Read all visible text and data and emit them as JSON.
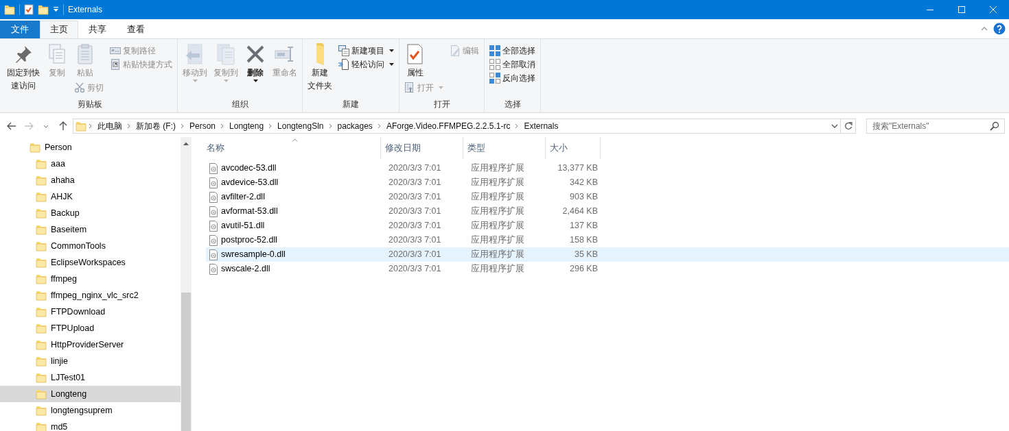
{
  "window": {
    "title": "Externals"
  },
  "ribbon": {
    "tabs": [
      {
        "label": "文件",
        "kind": "file",
        "selected": false
      },
      {
        "label": "主页",
        "kind": "tab",
        "selected": true
      },
      {
        "label": "共享",
        "kind": "tab",
        "selected": false
      },
      {
        "label": "查看",
        "kind": "tab",
        "selected": false
      }
    ],
    "groups": [
      {
        "label": "剪贴板",
        "columns": [
          [
            {
              "lines": [
                "固定到快",
                "速访问"
              ],
              "kind": "large",
              "disabled": false,
              "dropdown": false
            }
          ],
          [
            {
              "lines": [
                "复制"
              ],
              "kind": "large",
              "disabled": true,
              "dropdown": false
            }
          ],
          [
            {
              "lines": [
                "粘贴"
              ],
              "kind": "large",
              "disabled": true,
              "dropdown": false
            },
            {
              "lines": [
                "剪切"
              ],
              "kind": "small",
              "disabled": true,
              "dropdown": false
            }
          ],
          [
            {
              "lines": [
                "复制路径"
              ],
              "kind": "small",
              "disabled": true,
              "dropdown": false
            },
            {
              "lines": [
                "粘贴快捷方式"
              ],
              "kind": "small",
              "disabled": true,
              "dropdown": false
            }
          ]
        ]
      },
      {
        "label": "组织",
        "columns": [
          [
            {
              "lines": [
                "移动到"
              ],
              "kind": "large",
              "disabled": true,
              "dropdown": true
            }
          ],
          [
            {
              "lines": [
                "复制到"
              ],
              "kind": "large",
              "disabled": true,
              "dropdown": true
            }
          ],
          [
            {
              "lines": [
                "删除"
              ],
              "kind": "large",
              "disabled": false,
              "dropdown": true
            }
          ],
          [
            {
              "lines": [
                "重命名"
              ],
              "kind": "large",
              "disabled": true,
              "dropdown": false
            }
          ]
        ]
      },
      {
        "label": "新建",
        "columns": [
          [
            {
              "lines": [
                "新建",
                "文件夹"
              ],
              "kind": "large",
              "disabled": false,
              "dropdown": false
            }
          ],
          [
            {
              "lines": [
                "新建项目"
              ],
              "kind": "small",
              "disabled": false,
              "dropdown": true
            },
            {
              "lines": [
                "轻松访问"
              ],
              "kind": "small",
              "disabled": false,
              "dropdown": true
            }
          ]
        ]
      },
      {
        "label": "打开",
        "columns": [
          [
            {
              "lines": [
                "属性"
              ],
              "kind": "large",
              "disabled": false,
              "dropdown": false
            },
            {
              "lines": [
                "打开"
              ],
              "kind": "small",
              "disabled": true,
              "dropdown": true
            }
          ],
          [
            {
              "lines": [
                "编辑"
              ],
              "kind": "small",
              "disabled": true,
              "dropdown": false
            }
          ]
        ]
      },
      {
        "label": "选择",
        "columns": [
          [
            {
              "lines": [
                "全部选择"
              ],
              "kind": "small",
              "disabled": false,
              "dropdown": false
            },
            {
              "lines": [
                "全部取消"
              ],
              "kind": "small",
              "disabled": false,
              "dropdown": false
            },
            {
              "lines": [
                "反向选择"
              ],
              "kind": "small",
              "disabled": false,
              "dropdown": false
            }
          ]
        ]
      }
    ]
  },
  "navigation": {
    "back_disabled": false,
    "forward_disabled": true
  },
  "address": {
    "crumbs": [
      "此电脑",
      "新加卷 (F:)",
      "Person",
      "Longteng",
      "LongtengSln",
      "packages",
      "AForge.Video.FFMPEG.2.2.5.1-rc",
      "Externals"
    ]
  },
  "search": {
    "placeholder": "搜索\"Externals\""
  },
  "tree": [
    {
      "label": "Person",
      "selected": false,
      "children": [
        {
          "label": "aaa",
          "selected": false
        },
        {
          "label": "ahaha",
          "selected": false
        },
        {
          "label": "AHJK",
          "selected": false
        },
        {
          "label": "Backup",
          "selected": false
        },
        {
          "label": "Baseitem",
          "selected": false
        },
        {
          "label": "CommonTools",
          "selected": false
        },
        {
          "label": "EclipseWorkspaces",
          "selected": false
        },
        {
          "label": "ffmpeg",
          "selected": false
        },
        {
          "label": "ffmpeg_nginx_vlc_src2",
          "selected": false
        },
        {
          "label": "FTPDownload",
          "selected": false
        },
        {
          "label": "FTPUpload",
          "selected": false
        },
        {
          "label": "HttpProviderServer",
          "selected": false
        },
        {
          "label": "linjie",
          "selected": false
        },
        {
          "label": "LJTest01",
          "selected": false
        },
        {
          "label": "Longteng",
          "selected": true
        },
        {
          "label": "longtengsuprem",
          "selected": false
        },
        {
          "label": "md5",
          "selected": false
        }
      ]
    }
  ],
  "table": {
    "columns": [
      {
        "label": "名称",
        "sorted": true
      },
      {
        "label": "修改日期",
        "sorted": false
      },
      {
        "label": "类型",
        "sorted": false
      },
      {
        "label": "大小",
        "sorted": false
      }
    ],
    "rows": [
      {
        "name": "avcodec-53.dll",
        "date": "2020/3/3 7:01",
        "type": "应用程序扩展",
        "size": "13,377 KB",
        "selected": false
      },
      {
        "name": "avdevice-53.dll",
        "date": "2020/3/3 7:01",
        "type": "应用程序扩展",
        "size": "342 KB",
        "selected": false
      },
      {
        "name": "avfilter-2.dll",
        "date": "2020/3/3 7:01",
        "type": "应用程序扩展",
        "size": "903 KB",
        "selected": false
      },
      {
        "name": "avformat-53.dll",
        "date": "2020/3/3 7:01",
        "type": "应用程序扩展",
        "size": "2,464 KB",
        "selected": false
      },
      {
        "name": "avutil-51.dll",
        "date": "2020/3/3 7:01",
        "type": "应用程序扩展",
        "size": "137 KB",
        "selected": false
      },
      {
        "name": "postproc-52.dll",
        "date": "2020/3/3 7:01",
        "type": "应用程序扩展",
        "size": "158 KB",
        "selected": false
      },
      {
        "name": "swresample-0.dll",
        "date": "2020/3/3 7:01",
        "type": "应用程序扩展",
        "size": "35 KB",
        "selected": true
      },
      {
        "name": "swscale-2.dll",
        "date": "2020/3/3 7:01",
        "type": "应用程序扩展",
        "size": "296 KB",
        "selected": false
      }
    ]
  }
}
